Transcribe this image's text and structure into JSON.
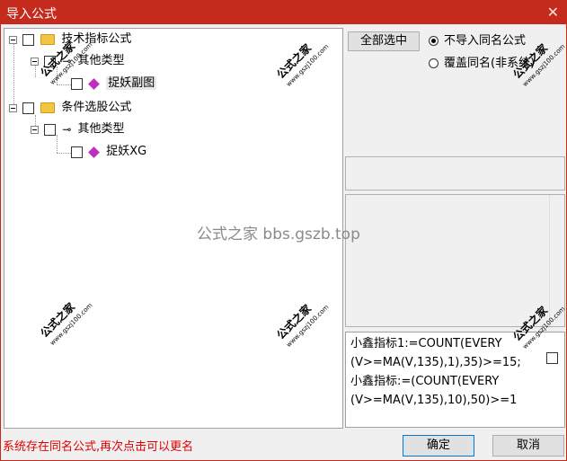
{
  "window": {
    "title": "导入公式",
    "close_glyph": "✕"
  },
  "tree": {
    "nodes": [
      {
        "label": "技术指标公式"
      },
      {
        "label": "其他类型"
      },
      {
        "label": "捉妖副图"
      },
      {
        "label": "条件选股公式"
      },
      {
        "label": "其他类型"
      },
      {
        "label": "捉妖XG"
      }
    ]
  },
  "controls": {
    "select_all": "全部选中",
    "radio_skip": "不导入同名公式",
    "radio_overwrite": "覆盖同名(非系统)"
  },
  "formula": {
    "lines": [
      "小鑫指标1:=COUNT(EVERY",
      "(V>=MA(V,135),1),35)>=15;",
      "小鑫指标:=(COUNT(EVERY",
      "(V>=MA(V,135),10),50)>=1"
    ]
  },
  "status": "系统存在同名公式,再次点击可以更名",
  "buttons": {
    "ok": "确定",
    "cancel": "取消"
  },
  "watermark": {
    "site": "公式之家 bbs.gszb.top",
    "logo_cn": "公式之家",
    "logo_url": "www.gszj100.com"
  },
  "colors": {
    "title_bar": "#c42b1c",
    "status_text": "#e00000",
    "gem": "#c02dc0",
    "folder": "#f5c542"
  }
}
